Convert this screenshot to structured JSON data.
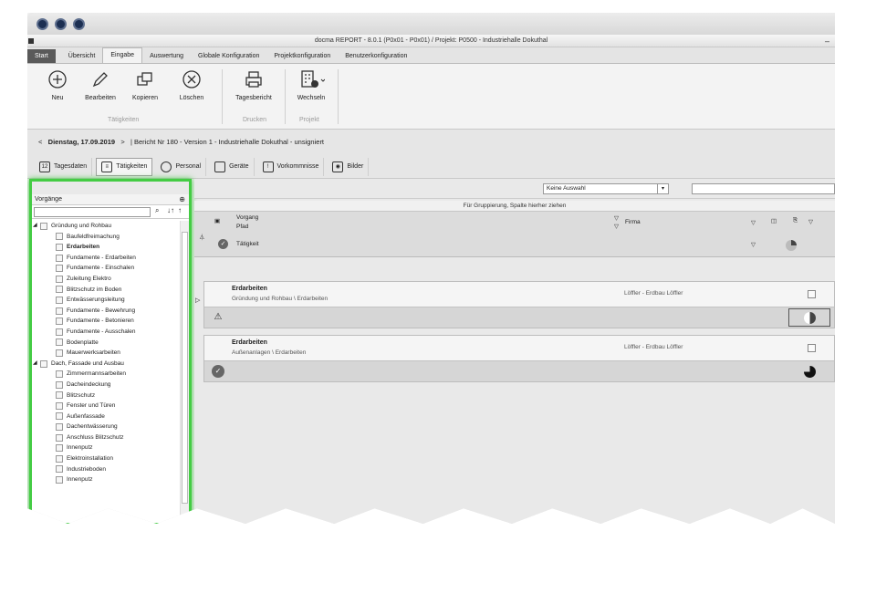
{
  "app": {
    "title": "docma REPORT - 8.0.1 (P0x01 - P0x01) / Projekt: P0500  - Industriehalle Dokuthal",
    "menu_tabs": [
      "Start",
      "Übersicht",
      "Eingabe",
      "Auswertung",
      "Globale Konfiguration",
      "Projektkonfiguration",
      "Benutzerkonfiguration"
    ]
  },
  "ribbon": {
    "buttons": {
      "neu": "Neu",
      "bearbeiten": "Bearbeiten",
      "kopieren": "Kopieren",
      "loeschen": "Löschen",
      "tagesbericht": "Tagesbericht",
      "wechseln": "Wechseln"
    },
    "groups": {
      "taetigkeiten": "Tätigkeiten",
      "drucken": "Drucken",
      "projekt": "Projekt"
    }
  },
  "report": {
    "nav_prev": "<",
    "date": "Dienstag, 17.09.2019",
    "nav_next": ">",
    "info": "| Bericht Nr 180 - Version 1 - Industriehalle Dokuthal - unsigniert"
  },
  "subtabs": [
    "Tagesdaten",
    "Tätigkeiten",
    "Personal",
    "Geräte",
    "Vorkommnisse",
    "Bilder"
  ],
  "left_panel": {
    "title": "Vorgänge",
    "tree": [
      {
        "label": "Gründung und Rohbau",
        "level": 0
      },
      {
        "label": "Baufeldfreimachung",
        "level": 1
      },
      {
        "label": "Erdarbeiten",
        "level": 1,
        "bold": true
      },
      {
        "label": "Fundamente - Erdarbeiten",
        "level": 1
      },
      {
        "label": "Fundamente - Einschalen",
        "level": 1
      },
      {
        "label": "Zuleitung Elektro",
        "level": 1
      },
      {
        "label": "Blitzschutz im Boden",
        "level": 1
      },
      {
        "label": "Entwässerungsleitung",
        "level": 1
      },
      {
        "label": "Fundamente - Bewehrung",
        "level": 1
      },
      {
        "label": "Fundamente - Betonieren",
        "level": 1
      },
      {
        "label": "Fundamente - Ausschalen",
        "level": 1
      },
      {
        "label": "Bodenplatte",
        "level": 1
      },
      {
        "label": "Mauerwerksarbeiten",
        "level": 1
      },
      {
        "label": "Dach, Fassade und Ausbau",
        "level": 0
      },
      {
        "label": "Zimmermannsarbeiten",
        "level": 1
      },
      {
        "label": "Dacheindeckung",
        "level": 1
      },
      {
        "label": "Blitzschutz",
        "level": 1
      },
      {
        "label": "Fenster und Türen",
        "level": 1
      },
      {
        "label": "Außenfassade",
        "level": 1
      },
      {
        "label": "Dachentwässerung",
        "level": 1
      },
      {
        "label": "Anschluss Blitzschutz",
        "level": 1
      },
      {
        "label": "Innenputz",
        "level": 1
      },
      {
        "label": "Elektroinstallation",
        "level": 1
      },
      {
        "label": "Industrieboden",
        "level": 1
      },
      {
        "label": "Innenputz",
        "level": 1
      }
    ]
  },
  "filter": {
    "selection": "Keine Auswahl"
  },
  "grid": {
    "group_hint": "Für Gruppierung, Spalte hierher ziehen",
    "columns": {
      "vorgang": "Vorgang",
      "pfad": "Pfad",
      "firma": "Firma",
      "taetigkeit": "Tätigkeit"
    },
    "rows": [
      {
        "title": "Erdarbeiten",
        "path": "Gründung und Rohbau \\ Erdarbeiten",
        "firma": "Löffler - Erdbau Löffler",
        "progress": 0.5
      },
      {
        "title": "Erdarbeiten",
        "path": "Außenanlagen \\ Erdarbeiten",
        "firma": "Löffler - Erdbau Löffler",
        "progress": 0.75
      }
    ]
  }
}
